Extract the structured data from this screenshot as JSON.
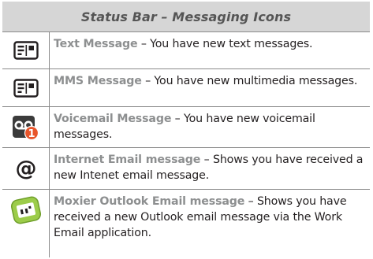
{
  "header": {
    "title": "Status Bar – Messaging Icons"
  },
  "rows": [
    {
      "icon": "text-message-icon",
      "name": "Text Message",
      "separator": " – ",
      "desc": "You have new text messages."
    },
    {
      "icon": "mms-message-icon",
      "name": "MMS Message",
      "separator": " – ",
      "desc": "You have new multimedia messages."
    },
    {
      "icon": "voicemail-icon",
      "name": "Voicemail Message",
      "separator": " – ",
      "desc": "You have new voicemail messages.",
      "badge": "1"
    },
    {
      "icon": "internet-email-icon",
      "name": "Internet Email message",
      "separator": " – ",
      "desc": "Shows you have received a new Intenet email message.",
      "glyph": "@"
    },
    {
      "icon": "moxier-outlook-email-icon",
      "name": "Moxier Outlook Email message",
      "separator": " – ",
      "desc": "Shows you have received a new Outlook email message via the Work Email application."
    }
  ],
  "colors": {
    "header_bg": "#d6d6d6",
    "name_text": "#8d8f90",
    "voicemail_badge": "#e8552a",
    "moxier_green": "#9ccc4a"
  }
}
